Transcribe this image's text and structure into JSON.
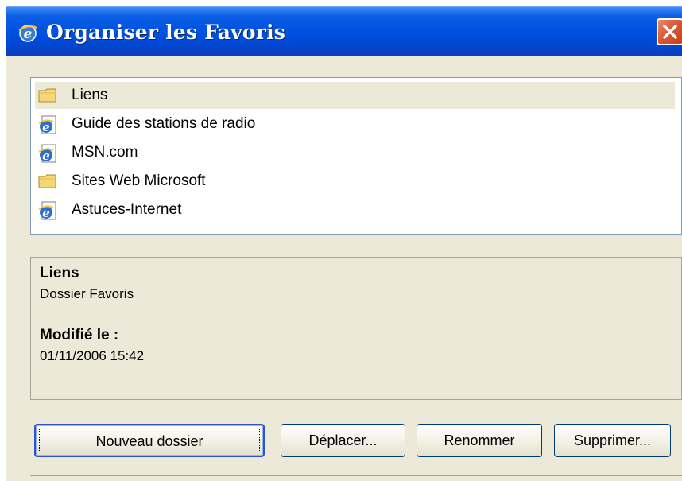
{
  "window": {
    "title": "Organiser les Favoris",
    "icon": "ie-icon",
    "close_icon": "close-icon"
  },
  "favorites": [
    {
      "label": "Liens",
      "type": "folder",
      "icon": "folder-icon",
      "selected": true
    },
    {
      "label": "Guide des stations de radio",
      "type": "link",
      "icon": "ie-page-icon",
      "selected": false
    },
    {
      "label": "MSN.com",
      "type": "link",
      "icon": "ie-page-icon",
      "selected": false
    },
    {
      "label": "Sites Web Microsoft",
      "type": "folder",
      "icon": "folder-icon",
      "selected": false
    },
    {
      "label": "Astuces-Internet",
      "type": "link",
      "icon": "ie-page-icon",
      "selected": false
    }
  ],
  "details": {
    "name": "Liens",
    "type": "Dossier Favoris",
    "modified_label": "Modifié le :",
    "modified_value": "01/11/2006 15:42"
  },
  "buttons": {
    "new_folder": "Nouveau dossier",
    "move": "Déplacer...",
    "rename": "Renommer",
    "delete": "Supprimer..."
  },
  "colors": {
    "titlebar": "#0054e3",
    "dialog_bg": "#ece9d8",
    "list_border": "#7f9db9",
    "close_button": "#d95a35"
  }
}
